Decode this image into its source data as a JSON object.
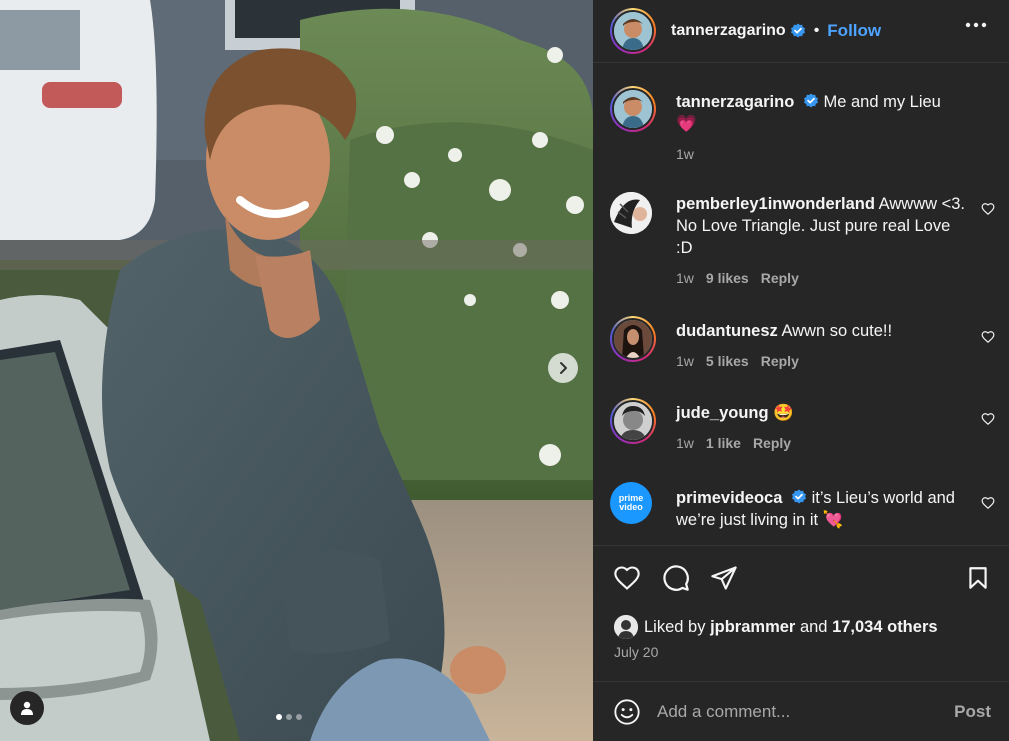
{
  "post": {
    "author": "tannerzagarino",
    "follow_label": "Follow",
    "separator": "•",
    "caption_text": "Me and my Lieu",
    "caption_emoji": "💗",
    "caption_time": "1w"
  },
  "comments": [
    {
      "username": "pemberley1inwonderland",
      "text": "Awwww <3. No Love Triangle. Just pure real Love :D",
      "time": "1w",
      "likes": "9 likes",
      "reply": "Reply"
    },
    {
      "username": "dudantunesz",
      "text": "Awwn so cute!!",
      "time": "1w",
      "likes": "5 likes",
      "reply": "Reply"
    },
    {
      "username": "jude_young",
      "text": "🤩",
      "time": "1w",
      "likes": "1 like",
      "reply": "Reply"
    },
    {
      "username": "primevideoca",
      "text": "it’s Lieu’s world and we’re just living in it 💘",
      "avatar_text": "prime video"
    }
  ],
  "likes": {
    "prefix": "Liked by",
    "user": "jpbrammer",
    "conj": "and",
    "others": "17,034 others"
  },
  "date": "July 20",
  "add_comment": {
    "placeholder": "Add a comment...",
    "post_label": "Post"
  },
  "carousel": {
    "slide": 1,
    "count": 3
  },
  "colors": {
    "accent": "#0095f6",
    "verified": "#3797f0",
    "panel": "#262626",
    "secondary_text": "#a8a8a8"
  },
  "icons": [
    "verified-badge-icon",
    "more-options-icon",
    "heart-icon",
    "comment-icon",
    "share-icon",
    "save-icon",
    "emoji-icon",
    "next-arrow-icon",
    "user-tag-icon"
  ]
}
